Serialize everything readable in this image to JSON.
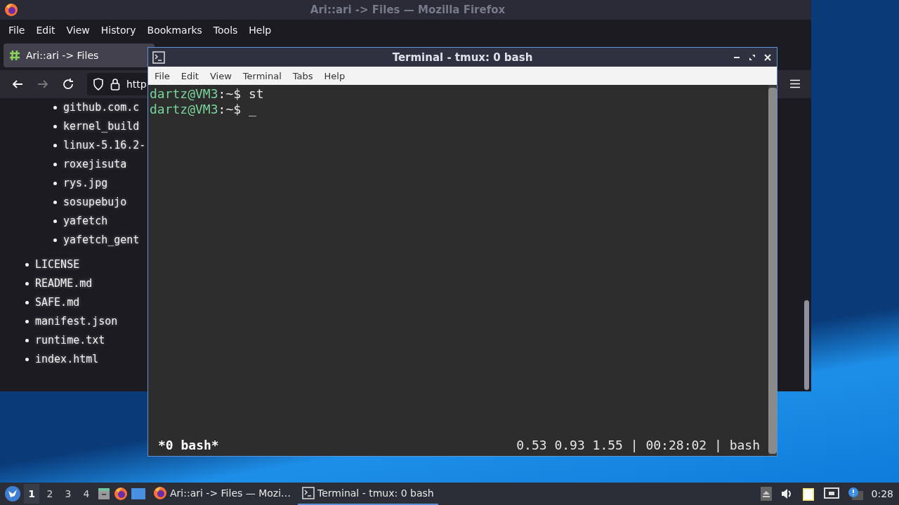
{
  "browser": {
    "title": "Ari::ari -> Files — Mozilla Firefox",
    "menu": [
      "File",
      "Edit",
      "View",
      "History",
      "Bookmarks",
      "Tools",
      "Help"
    ],
    "tabs": [
      {
        "label": "Ari::ari -> Files",
        "selected": true
      }
    ],
    "url": "http",
    "files": [
      {
        "children": [
          {
            "label": "github.com.c"
          },
          {
            "label": "kernel_build"
          },
          {
            "label": "linux-5.16.2-"
          },
          {
            "label": "roxejisuta"
          },
          {
            "label": "rys.jpg"
          },
          {
            "label": "sosupebujo"
          },
          {
            "label": "yafetch"
          },
          {
            "label": "yafetch_gent"
          }
        ]
      },
      {
        "label": "LICENSE"
      },
      {
        "label": "README.md"
      },
      {
        "label": "SAFE.md"
      },
      {
        "label": "manifest.json"
      },
      {
        "label": "runtime.txt"
      },
      {
        "label": "index.html"
      }
    ]
  },
  "terminal": {
    "title": "Terminal - tmux: 0 bash",
    "menu": [
      "File",
      "Edit",
      "View",
      "Terminal",
      "Tabs",
      "Help"
    ],
    "lines": [
      {
        "prompt": "dartz@VM3",
        "path": ":~$ ",
        "command": "st"
      },
      {
        "prompt": "dartz@VM3",
        "path": ":~$ ",
        "command": "_"
      }
    ],
    "status_left": "*0 bash*",
    "status_right": "0.53 0.93 1.55 | 00:28:02 | bash"
  },
  "taskbar": {
    "workspaces": [
      {
        "label": "1",
        "selected": true
      },
      {
        "label": "2",
        "selected": false
      },
      {
        "label": "3",
        "selected": false
      },
      {
        "label": "4",
        "selected": false
      }
    ],
    "tasks": [
      {
        "label": "Ari::ari -> Files — Mozi…",
        "kind": "browser",
        "selected": false
      },
      {
        "label": "Terminal - tmux: 0 bash",
        "kind": "terminal",
        "selected": true
      }
    ],
    "clock": "0:28"
  }
}
